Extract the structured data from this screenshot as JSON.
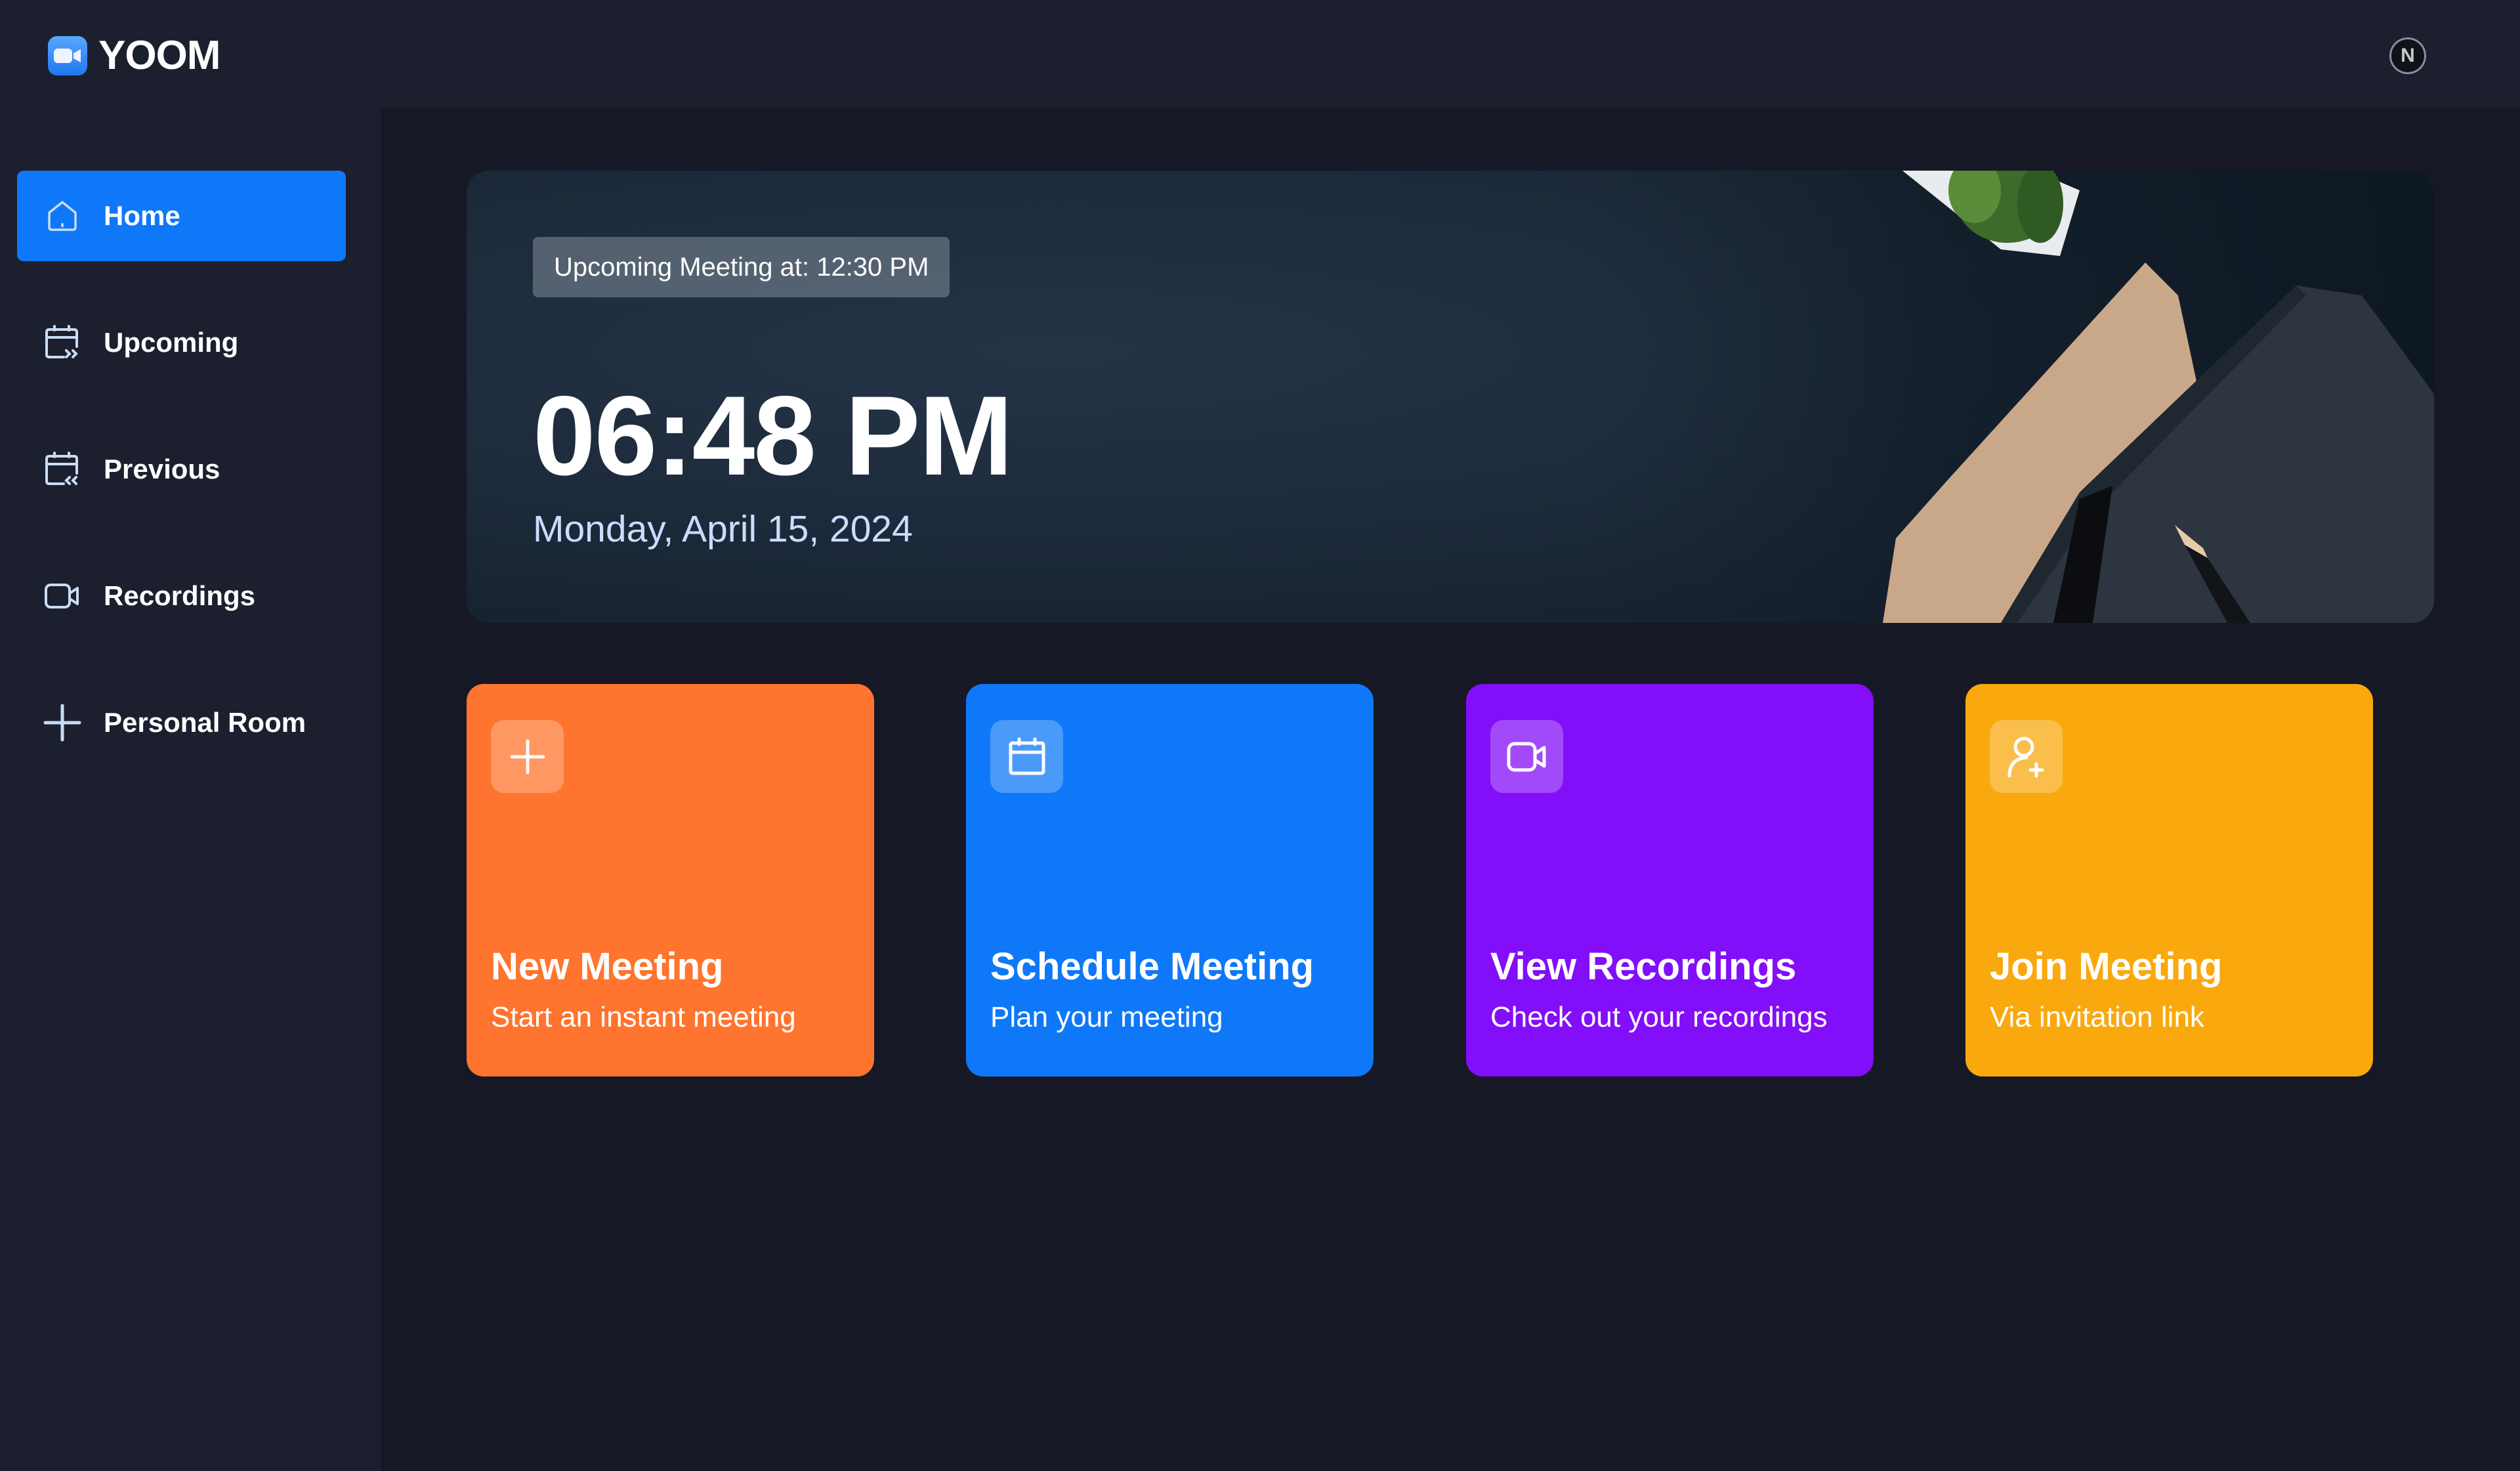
{
  "app": {
    "name": "YOOM",
    "logo_icon": "video-camera-icon",
    "user_avatar_initial": "N"
  },
  "sidebar": {
    "items": [
      {
        "label": "Home",
        "icon": "home-icon",
        "active": true
      },
      {
        "label": "Upcoming",
        "icon": "calendar-forward-icon",
        "active": false
      },
      {
        "label": "Previous",
        "icon": "calendar-back-icon",
        "active": false
      },
      {
        "label": "Recordings",
        "icon": "video-icon",
        "active": false
      },
      {
        "label": "Personal Room",
        "icon": "plus-icon",
        "active": false
      }
    ]
  },
  "hero": {
    "upcoming_label": "Upcoming Meeting at: 12:30 PM",
    "time": "06:48 PM",
    "date": "Monday, April 15, 2024"
  },
  "cards": [
    {
      "title": "New Meeting",
      "subtitle": "Start an instant meeting",
      "icon": "plus-icon",
      "color": "#ff742e"
    },
    {
      "title": "Schedule Meeting",
      "subtitle": "Plan your meeting",
      "icon": "calendar-icon",
      "color": "#0e78f9"
    },
    {
      "title": "View Recordings",
      "subtitle": "Check out your recordings",
      "icon": "video-icon",
      "color": "#830ef9"
    },
    {
      "title": "Join Meeting",
      "subtitle": "Via invitation link",
      "icon": "user-plus-icon",
      "color": "#f9a90e"
    }
  ],
  "colors": {
    "accent": "#0e78f9",
    "sidebar_bg": "#1c1f2e",
    "main_bg": "#161925",
    "date_text": "#c9ddff",
    "icon_tint": "#c9dcf6"
  }
}
